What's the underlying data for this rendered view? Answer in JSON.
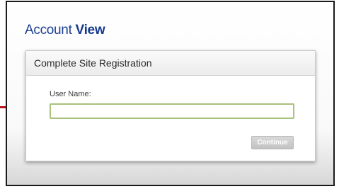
{
  "app": {
    "title_prefix": "Account",
    "title_strong": "View"
  },
  "registration": {
    "header": "Complete Site Registration",
    "username_label": "User Name:",
    "username_value": "",
    "continue_label": "Continue",
    "continue_enabled": false
  },
  "colors": {
    "brand_blue": "#1c3f95",
    "input_border": "#a9c27c",
    "pointer_red": "#b8151b"
  }
}
